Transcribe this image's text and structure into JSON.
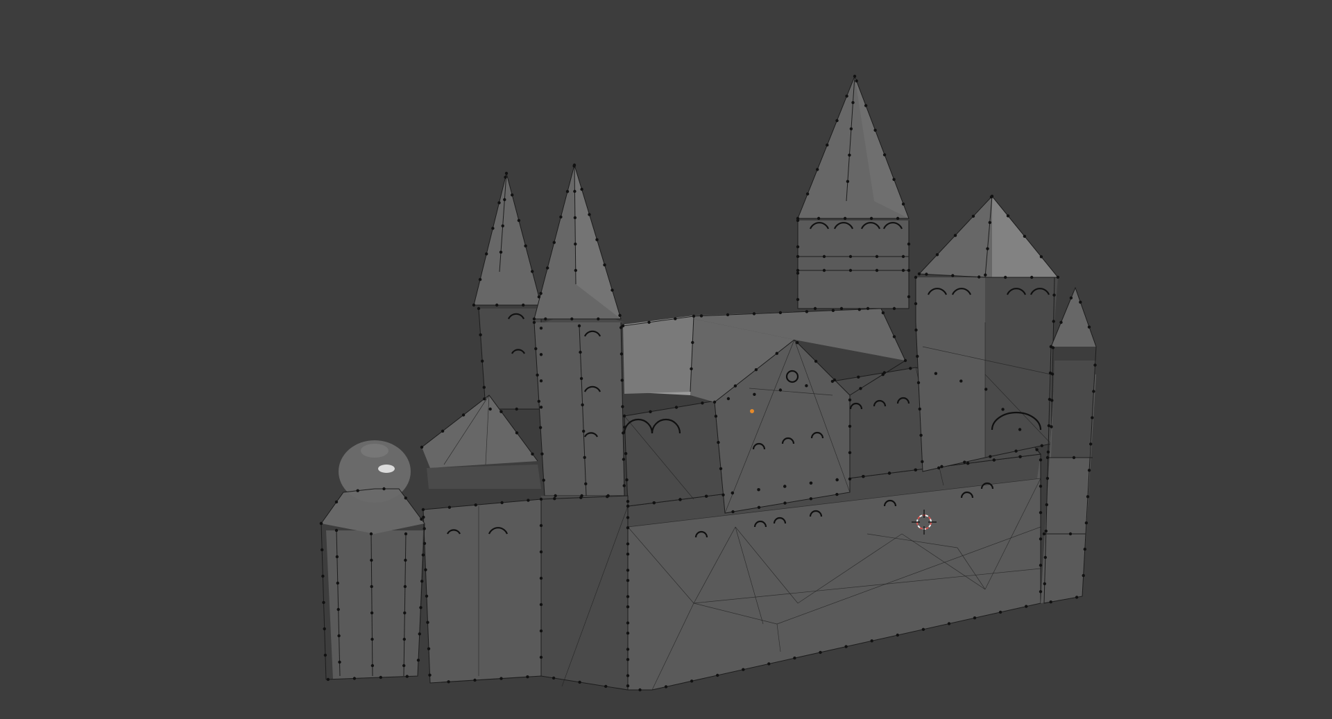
{
  "viewport": {
    "background": "#3d3d3d",
    "mode": "edit-mode-wireframe-overlay",
    "model": "cathedral-mesh"
  },
  "colors": {
    "mesh_face": "#5a5a5a",
    "mesh_edge": "#1c1c1c",
    "vertex": "#111111",
    "origin_point": "#e58a2b",
    "cursor_red": "#d9534f",
    "cursor_white": "#f2f2f2"
  },
  "icons": [
    "3d-cursor-icon",
    "object-origin-icon"
  ]
}
